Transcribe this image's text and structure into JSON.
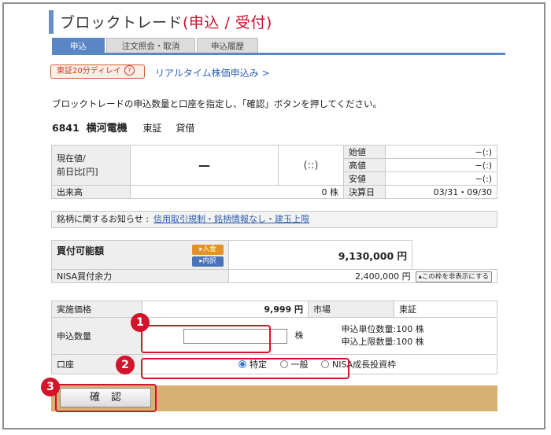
{
  "title": {
    "main": "ブロックトレード",
    "sub": "(申込 / 受付)"
  },
  "tabs": [
    {
      "label": "申込",
      "active": true
    },
    {
      "label": "注文照会・取消",
      "active": false
    },
    {
      "label": "申込履歴",
      "active": false
    }
  ],
  "delay_badge": {
    "label": "東証20分ディレイ",
    "icon": "?"
  },
  "realtime_link": "リアルタイム株価申込み >",
  "instruction": "ブロックトレードの申込数量と口座を指定し、「確認」ボタンを押してください。",
  "stock": {
    "code": "6841",
    "name": "横河電機",
    "market": "東証",
    "type": "貸借"
  },
  "quote": {
    "current_label_line1": "現在値/",
    "current_label_line2": "前日比[円]",
    "current_value": "—",
    "current_time": "(::)",
    "open_label": "始値",
    "open_value": "−(:)",
    "high_label": "高値",
    "high_value": "−(:)",
    "low_label": "安値",
    "low_value": "−(:)",
    "volume_label": "出来高",
    "volume_value": "0 株",
    "settlement_label": "決算日",
    "settlement_value": "03/31・09/30"
  },
  "notice": {
    "label": "銘柄に関するお知らせ :",
    "link": "信用取引規制・銘柄情報なし・建玉上限"
  },
  "buying_power": {
    "label": "買付可能額",
    "deposit_btn": "▸入金",
    "detail_btn": "▸内訳",
    "value": "9,130,000 円",
    "nisa_label": "NISA買付余力",
    "nisa_value": "2,400,000 円",
    "hide_btn": "▴この枠を非表示にする"
  },
  "order": {
    "price_label": "実施価格",
    "price_value": "9,999 円",
    "market_label": "市場",
    "market_value": "東証",
    "qty_label": "申込数量",
    "qty_value": "",
    "qty_unit": "株",
    "unit_note": "申込単位数量:100 株",
    "limit_note": "申込上限数量:100 株",
    "account_label": "口座",
    "accounts": [
      "特定",
      "一般",
      "NISA成長投資枠"
    ],
    "selected_account": "特定"
  },
  "confirm_label": "確認",
  "callouts": [
    "1",
    "2",
    "3"
  ],
  "colors": {
    "accent": "#5a86c6",
    "highlight": "#d2142c",
    "confirm_bg": "#d7b172"
  }
}
